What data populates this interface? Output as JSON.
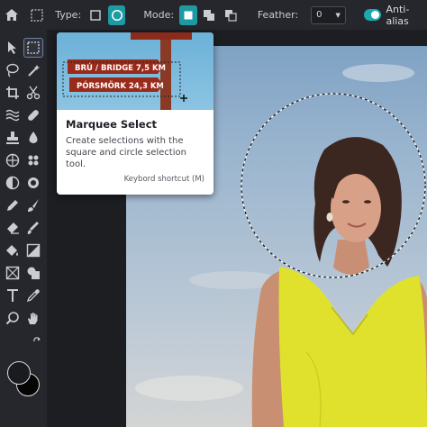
{
  "topbar": {
    "type_label": "Type:",
    "mode_label": "Mode:",
    "feather_label": "Feather:",
    "feather_value": "0",
    "antialias_label": "Anti-alias",
    "antialias_on": true,
    "accent_color": "#1e9aa3"
  },
  "toolbar": {
    "tools": [
      {
        "name": "move-icon"
      },
      {
        "name": "marquee-icon"
      },
      {
        "name": "lasso-icon"
      },
      {
        "name": "quick-select-icon"
      },
      {
        "name": "crop-icon"
      },
      {
        "name": "cut-icon"
      },
      {
        "name": "liquify-icon"
      },
      {
        "name": "bandage-icon"
      },
      {
        "name": "clone-stamp-icon"
      },
      {
        "name": "blur-icon"
      },
      {
        "name": "sponge-icon"
      },
      {
        "name": "color-replace-icon"
      },
      {
        "name": "dodge-icon"
      },
      {
        "name": "burn-icon"
      },
      {
        "name": "pencil-icon"
      },
      {
        "name": "brush-icon"
      },
      {
        "name": "eraser-icon"
      },
      {
        "name": "smudge-icon"
      },
      {
        "name": "paint-bucket-icon"
      },
      {
        "name": "gradient-icon"
      },
      {
        "name": "frame-icon"
      },
      {
        "name": "shape-icon"
      },
      {
        "name": "text-icon"
      },
      {
        "name": "eyedropper-icon"
      },
      {
        "name": "zoom-icon"
      },
      {
        "name": "hand-icon"
      }
    ]
  },
  "tooltip": {
    "title": "Marquee Select",
    "description": "Create selections with the square and circle selection tool.",
    "shortcut": "Keybord shortcut (M)",
    "sign_top": "BRÚ / BRIDGE 7,5 KM",
    "sign_bottom": "PÓRSMÖRK 24,3 KM"
  }
}
